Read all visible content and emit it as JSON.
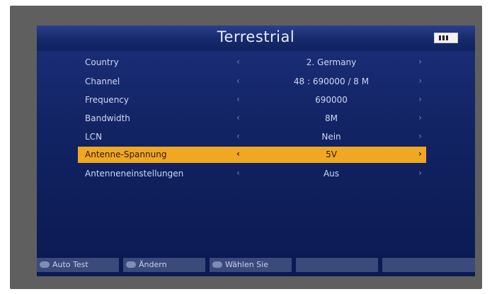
{
  "header": {
    "title": "Terrestrial",
    "battery_icon": "battery-icon"
  },
  "menu": {
    "rows": [
      {
        "label": "Country",
        "value": "2. Germany"
      },
      {
        "label": "Channel",
        "value": "48 : 690000 / 8 M"
      },
      {
        "label": "Frequency",
        "value": "690000"
      },
      {
        "label": "Bandwidth",
        "value": "8M"
      },
      {
        "label": "LCN",
        "value": "Nein"
      },
      {
        "label": "Antenne-Spannung",
        "value": "5V",
        "selected": true
      },
      {
        "label": "Antenneneinstellungen",
        "value": "Aus"
      }
    ],
    "arrow_left": "‹",
    "arrow_right": "›"
  },
  "footer": {
    "buttons": [
      {
        "label": "Auto Test"
      },
      {
        "label": "Ändern"
      },
      {
        "label": "Wählen Sie"
      }
    ]
  },
  "colors": {
    "background": "#0b1a52",
    "selected_row": "#f0a823",
    "text": "#cfd7f2"
  }
}
